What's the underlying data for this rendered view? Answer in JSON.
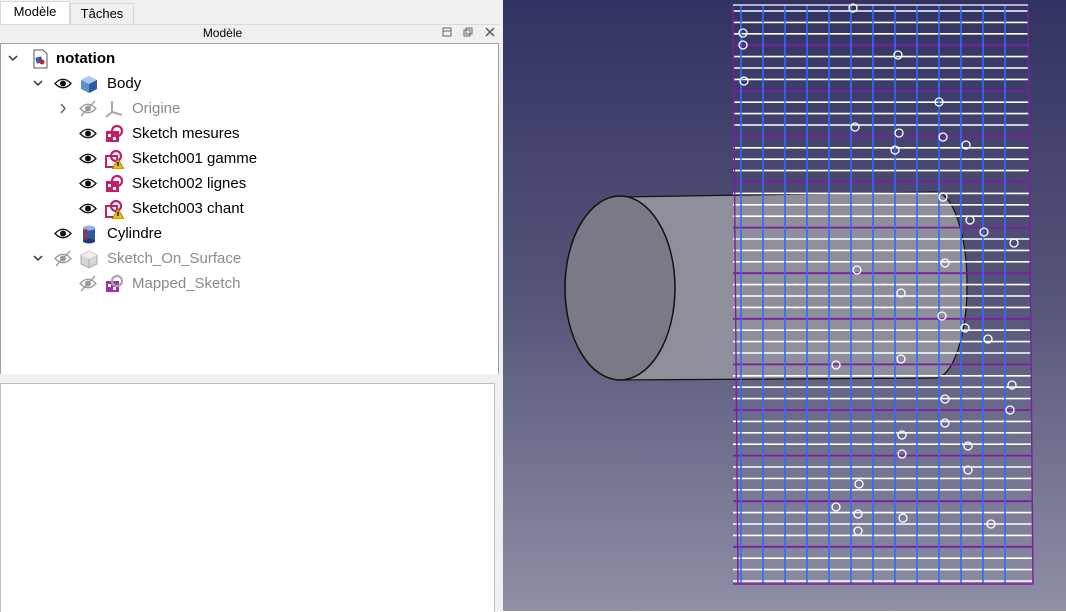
{
  "tabs": [
    {
      "label": "Modèle",
      "active": true
    },
    {
      "label": "Tâches",
      "active": false
    }
  ],
  "dock": {
    "title": "Modèle",
    "icons": [
      "float-icon",
      "restore-icon",
      "close-icon"
    ]
  },
  "tree": [
    {
      "label": "notation",
      "icon": "document-icon",
      "expanded": true,
      "bold": true
    },
    {
      "label": "Body",
      "icon": "body-icon",
      "expanded": true,
      "visible": true
    },
    {
      "label": "Origine",
      "icon": "origin-axes-icon",
      "expanded": false,
      "visible": false
    },
    {
      "label": "Sketch mesures",
      "icon": "sketch-icon",
      "visible": true
    },
    {
      "label": "Sketch001 gamme",
      "icon": "sketch-warning-icon",
      "visible": true
    },
    {
      "label": "Sketch002 lignes",
      "icon": "sketch-icon",
      "visible": true
    },
    {
      "label": "Sketch003 chant",
      "icon": "sketch-warning-icon",
      "visible": true
    },
    {
      "label": "Cylindre",
      "icon": "cylinder-icon",
      "visible": true
    },
    {
      "label": "Sketch_On_Surface",
      "icon": "part-compound-icon",
      "expanded": true,
      "visible": false
    },
    {
      "label": "Mapped_Sketch",
      "icon": "sketch-icon",
      "visible": false
    }
  ],
  "viewport": {
    "background_top": "#333363",
    "background_bottom": "#8f8fa6",
    "cylinder_color": "#8a8a96",
    "grid_blue": "#2f6bff",
    "grid_white": "#ffffff",
    "grid_purple": "#7a1fa0"
  }
}
